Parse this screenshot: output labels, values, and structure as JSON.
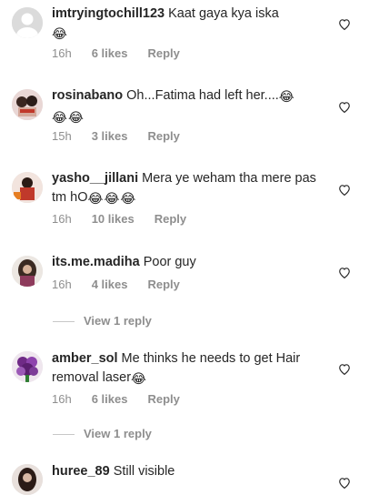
{
  "emoji": "😂",
  "comments": [
    {
      "username": "imtryingtochill123",
      "text": "Kaat gaya kya iska",
      "emoji_count": 1,
      "time": "16h",
      "likes": "6 likes",
      "reply": "Reply"
    },
    {
      "username": "rosinabano",
      "text": "Oh...Fatima had left her....",
      "emoji_count": 3,
      "time": "15h",
      "likes": "3 likes",
      "reply": "Reply"
    },
    {
      "username": "yasho__jillani",
      "text": "Mera ye weham tha mere pas tm hO",
      "emoji_count": 3,
      "time": "16h",
      "likes": "10 likes",
      "reply": "Reply"
    },
    {
      "username": "its.me.madiha",
      "text": "Poor guy",
      "emoji_count": 0,
      "time": "16h",
      "likes": "4 likes",
      "reply": "Reply",
      "view_replies": "View 1 reply"
    },
    {
      "username": "amber_sol",
      "text": "Me thinks he needs to get Hair removal laser",
      "emoji_count": 1,
      "time": "16h",
      "likes": "6 likes",
      "reply": "Reply",
      "view_replies": "View 1 reply"
    },
    {
      "username": "huree_89",
      "text": "Still visible",
      "emoji_count": 0
    }
  ],
  "icons": {
    "heart": "heart-outline-icon",
    "emoji": "face-with-tears-of-joy-icon"
  }
}
